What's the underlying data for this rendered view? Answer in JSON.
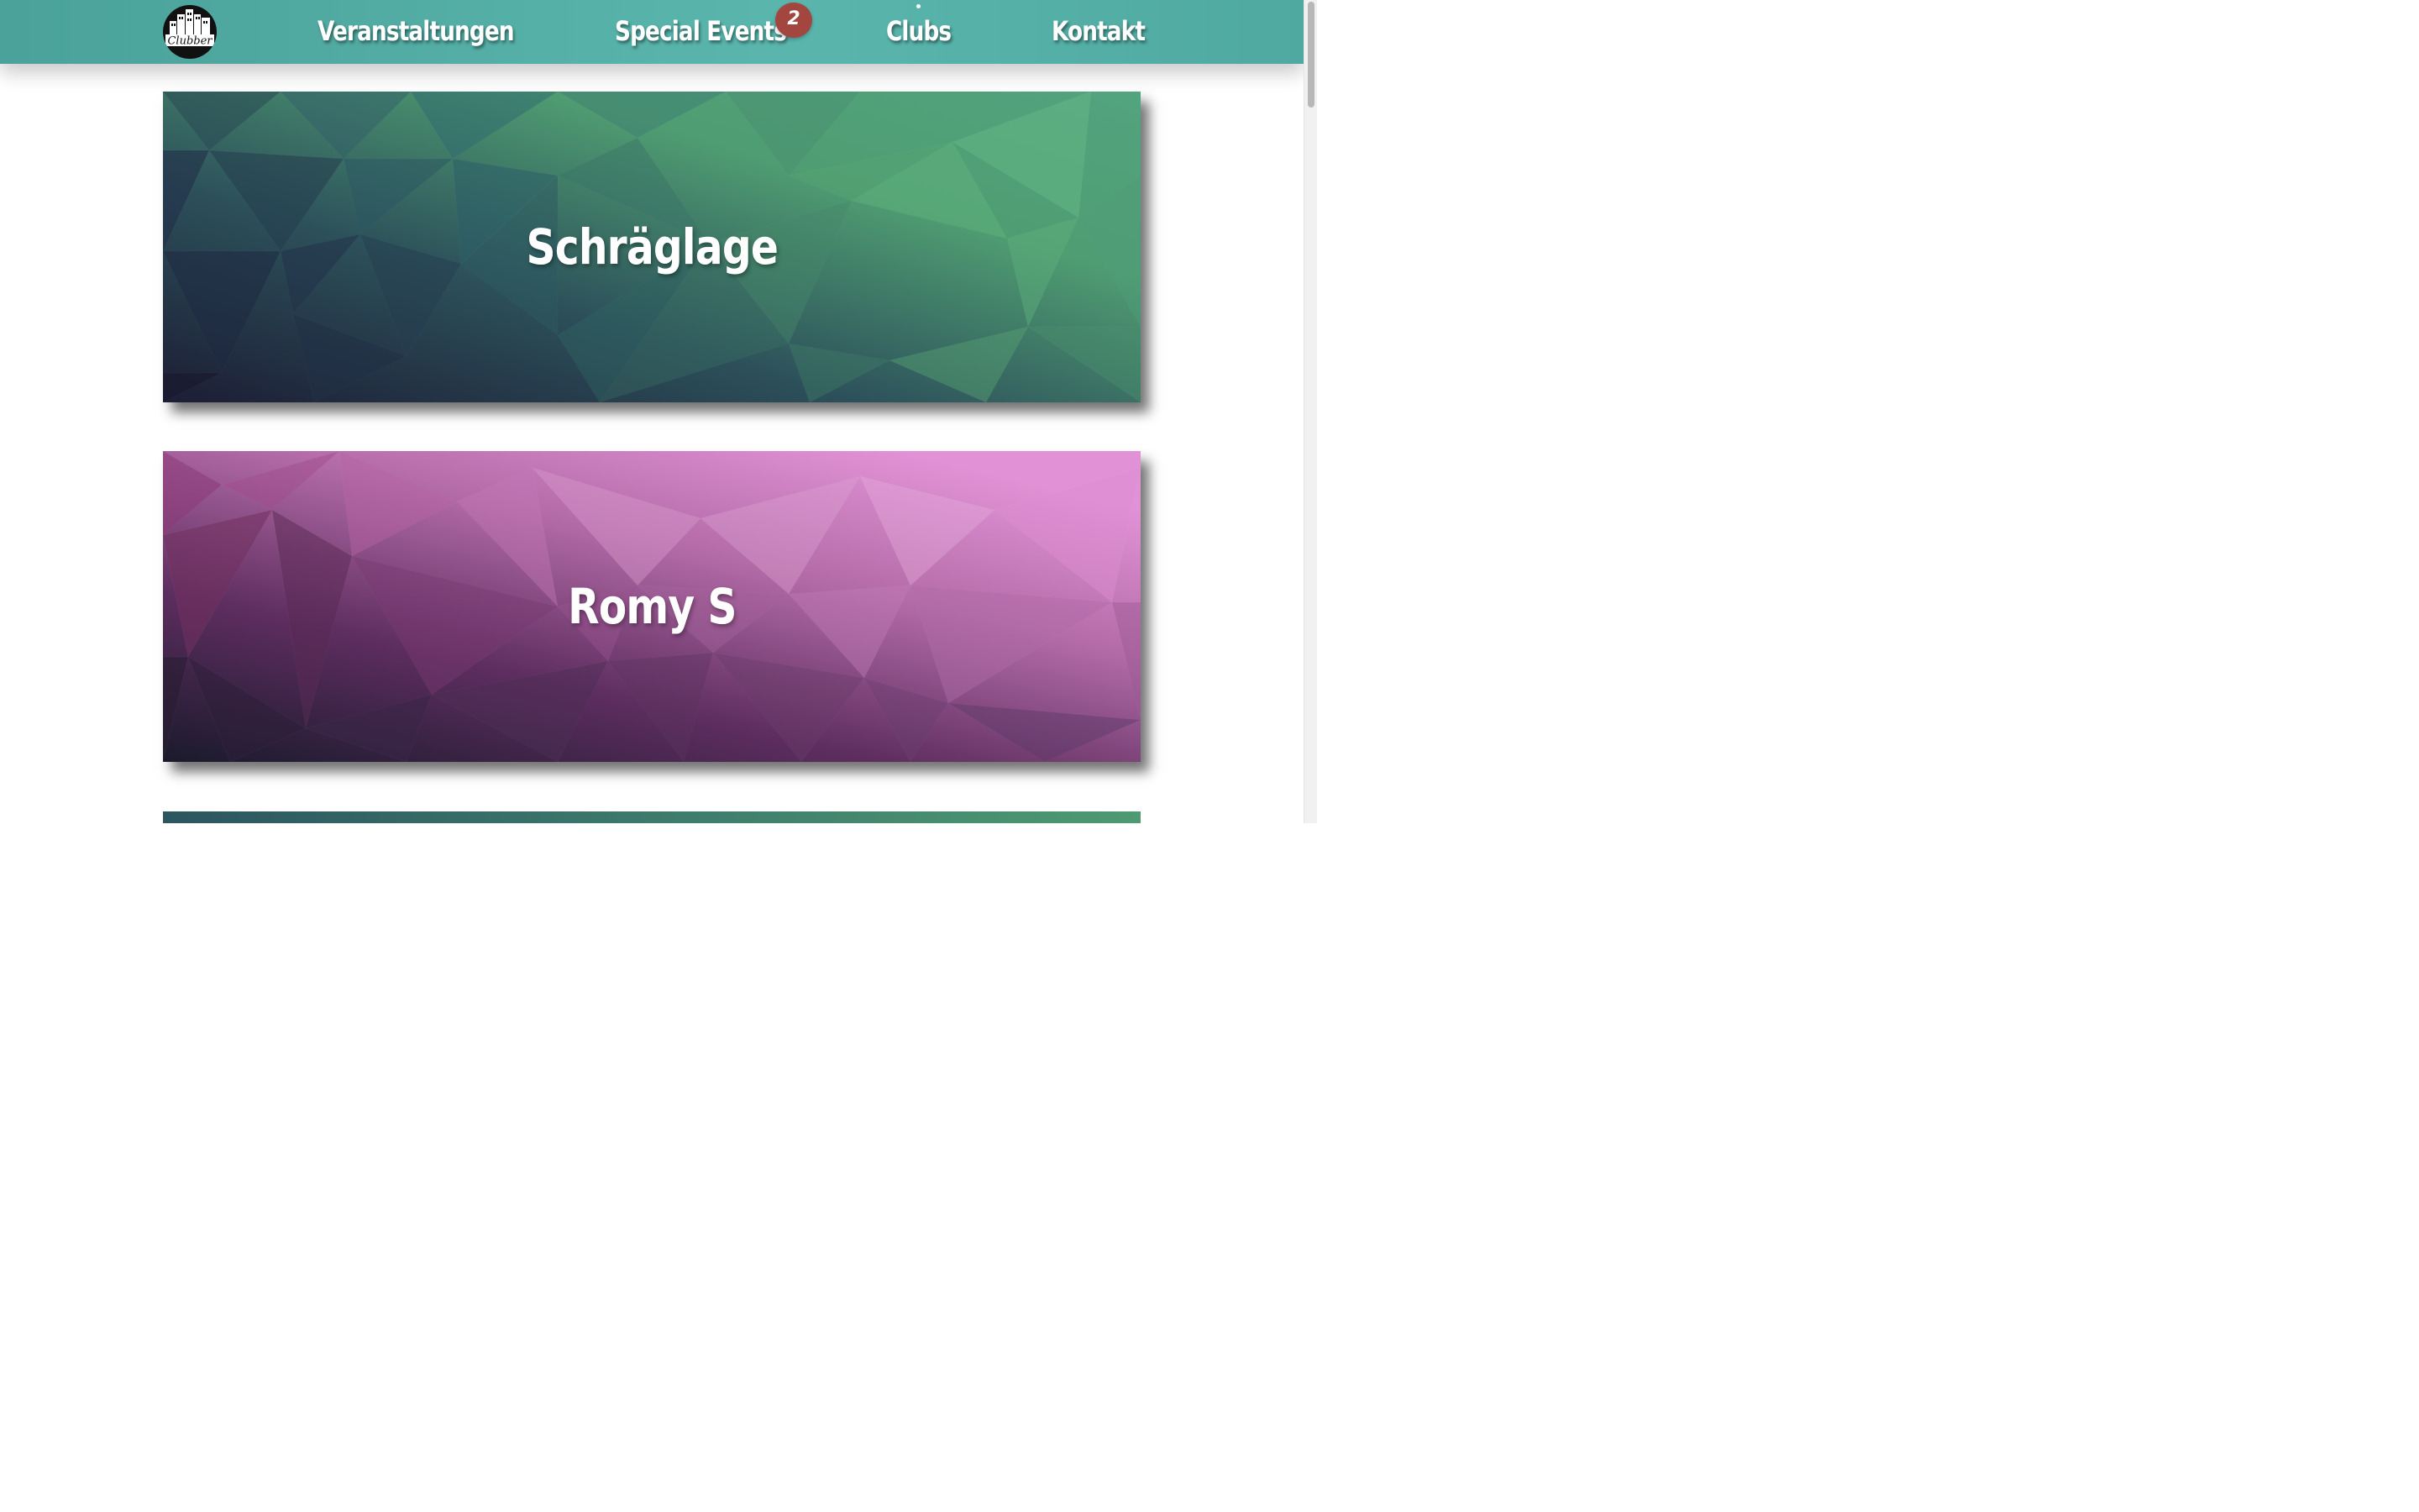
{
  "header": {
    "logo_text": "Clubber",
    "nav": [
      {
        "label": "Veranstaltungen"
      },
      {
        "label": "Special Events",
        "badge": "2"
      },
      {
        "label": "Clubs"
      },
      {
        "label": "Kontakt"
      }
    ]
  },
  "clubs": [
    {
      "name": "Schräglage",
      "theme": "green-teal",
      "colors": [
        "#1d2238",
        "#2c5560",
        "#4e9a72",
        "#5cb17d"
      ]
    },
    {
      "name": "Romy S",
      "theme": "pink-purple",
      "colors": [
        "#1c1c2e",
        "#5a2a5a",
        "#b36aa6",
        "#e190d6"
      ]
    },
    {
      "name": "",
      "theme": "green-teal",
      "colors": [
        "#2c5560",
        "#4e9a72"
      ]
    }
  ],
  "colors": {
    "header_bg": "#53ada4",
    "badge_bg": "#a3463f",
    "text_light": "#ffffff"
  }
}
